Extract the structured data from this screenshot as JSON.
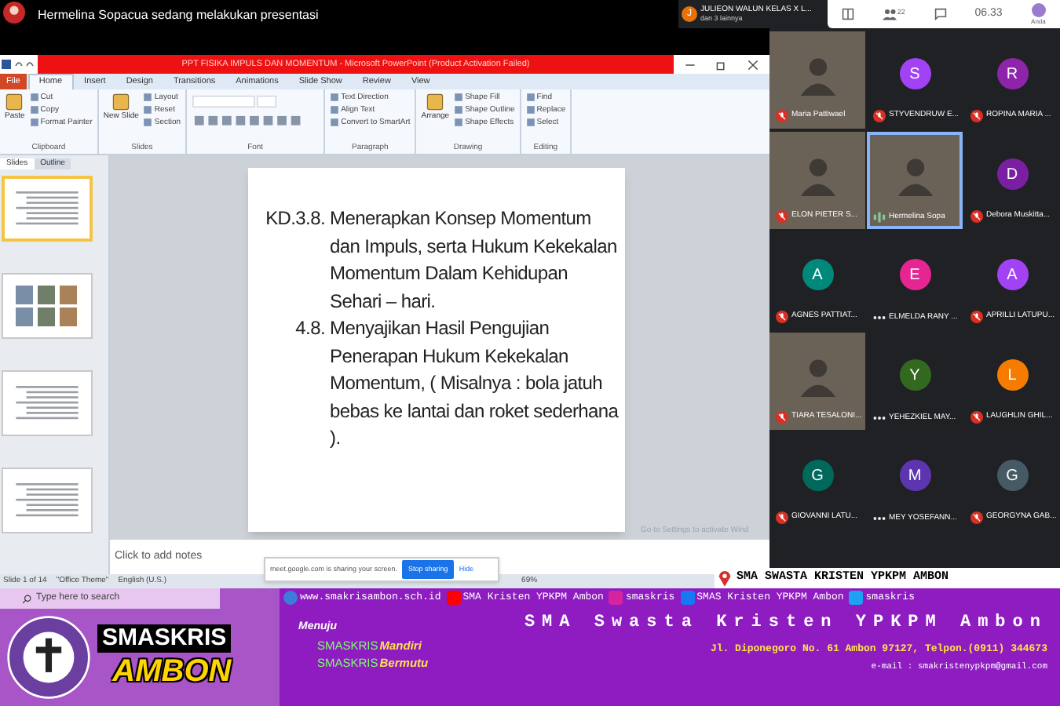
{
  "presenter_bar": {
    "title": "Hermelina Sopacua sedang melakukan presentasi",
    "notice": {
      "initial": "J",
      "name": "JULIEON WALUN KELAS X L...",
      "more": "dan 3 lainnya"
    }
  },
  "meet_toolbar": {
    "participants": "22",
    "time": "06.33",
    "user_label": "Anda"
  },
  "powerpoint": {
    "title": "PPT FISIKA IMPULS DAN MOMENTUM - Microsoft PowerPoint (Product Activation Failed)",
    "tabs": [
      {
        "label": "File",
        "kind": "file",
        "selected": false
      },
      {
        "label": "Home",
        "kind": "tab",
        "selected": true
      },
      {
        "label": "Insert",
        "kind": "tab",
        "selected": false
      },
      {
        "label": "Design",
        "kind": "tab",
        "selected": false
      },
      {
        "label": "Transitions",
        "kind": "tab",
        "selected": false
      },
      {
        "label": "Animations",
        "kind": "tab",
        "selected": false
      },
      {
        "label": "Slide Show",
        "kind": "tab",
        "selected": false
      },
      {
        "label": "Review",
        "kind": "tab",
        "selected": false
      },
      {
        "label": "View",
        "kind": "tab",
        "selected": false
      }
    ],
    "ribbon_groups": [
      {
        "label": "Clipboard",
        "big": "Paste",
        "commands": [
          "Cut",
          "Copy",
          "Format Painter"
        ]
      },
      {
        "label": "Slides",
        "big": "New Slide",
        "commands": [
          "Layout",
          "Reset",
          "Section"
        ]
      },
      {
        "label": "Font",
        "kind": "font"
      },
      {
        "label": "Paragraph",
        "commands": [
          "Text Direction",
          "Align Text",
          "Convert to SmartArt"
        ]
      },
      {
        "label": "Drawing",
        "big": "Arrange",
        "commands": [
          "Shape Fill",
          "Shape Outline",
          "Shape Effects"
        ]
      },
      {
        "label": "Editing",
        "commands": [
          "Find",
          "Replace",
          "Select"
        ]
      }
    ],
    "pane_tabs": [
      {
        "label": "Slides",
        "selected": true
      },
      {
        "label": "Outline",
        "selected": false
      }
    ],
    "thumbnails": [
      {
        "kind": "text",
        "selected": true
      },
      {
        "kind": "images",
        "selected": false
      },
      {
        "kind": "text",
        "selected": false
      },
      {
        "kind": "text",
        "selected": false
      }
    ],
    "slide": {
      "items": [
        {
          "number": "KD.3.8.",
          "text": "Menerapkan Konsep Momentum dan Impuls, serta Hukum Kekekalan Momentum Dalam Kehidupan Sehari – hari."
        },
        {
          "number": "4.8.",
          "text": "Menyajikan Hasil Pengujian Penerapan Hukum Kekekalan Momentum, ( Misalnya : bola jatuh bebas ke lantai dan roket sederhana )."
        }
      ]
    },
    "notes_placeholder": "Click to add notes",
    "status_bar": [
      "Slide 1 of 14",
      "\"Office Theme\"",
      "English (U.S.)"
    ],
    "zoom": "69%",
    "activation_notice": "Go to Settings to activate Wind"
  },
  "share_bar": {
    "message": "meet.google.com is sharing your screen.",
    "stop": "Stop sharing",
    "hide": "Hide"
  },
  "taskbar": {
    "search_placeholder": "Type here to search"
  },
  "gallery": [
    {
      "name": "Maria Pattiwael",
      "kind": "video",
      "muted": true,
      "speaking": false
    },
    {
      "name": "STYVENDRUW E...",
      "kind": "avatar",
      "initial": "S",
      "color": "#a142f4",
      "muted": true,
      "speaking": false
    },
    {
      "name": "ROPINA MARIA ...",
      "kind": "avatar",
      "initial": "R",
      "color": "#8e24aa",
      "muted": true,
      "speaking": false
    },
    {
      "name": "ELON PIETER S...",
      "kind": "video",
      "muted": true,
      "speaking": false
    },
    {
      "name": "Hermelina Sopa",
      "kind": "video",
      "muted": false,
      "speaking": true
    },
    {
      "name": "Debora Muskitta...",
      "kind": "avatar",
      "initial": "D",
      "color": "#7b1fa2",
      "muted": true,
      "speaking": false
    },
    {
      "name": "AGNES PATTIAT...",
      "kind": "avatar",
      "initial": "A",
      "color": "#00897b",
      "muted": true,
      "speaking": false
    },
    {
      "name": "ELMELDA RANY ...",
      "kind": "avatar",
      "initial": "E",
      "color": "#e52592",
      "muted": false,
      "speaking": false
    },
    {
      "name": "APRILLI LATUPU...",
      "kind": "avatar",
      "initial": "A",
      "color": "#a142f4",
      "muted": true,
      "speaking": false
    },
    {
      "name": "TIARA TESALONI...",
      "kind": "video",
      "muted": true,
      "speaking": false
    },
    {
      "name": "YEHEZKIEL MAY...",
      "kind": "avatar",
      "initial": "Y",
      "color": "#33691e",
      "muted": false,
      "speaking": false
    },
    {
      "name": "LAUGHLIN GHIL...",
      "kind": "avatar",
      "initial": "L",
      "color": "#f57c00",
      "muted": true,
      "speaking": false
    },
    {
      "name": "GIOVANNI LATU...",
      "kind": "avatar",
      "initial": "G",
      "color": "#00695c",
      "muted": true,
      "speaking": false
    },
    {
      "name": "MEY YOSEFANN...",
      "kind": "avatar",
      "initial": "M",
      "color": "#5e35b1",
      "muted": false,
      "speaking": false
    },
    {
      "name": "GEORGYNA GAB...",
      "kind": "avatar",
      "initial": "G",
      "color": "#455a64",
      "muted": true,
      "speaking": false
    }
  ],
  "school_strip": "SMA SWASTA KRISTEN YPKPM AMBON",
  "banner": {
    "logo_top": "SMASKRIS",
    "logo_bottom": "AMBON",
    "links": [
      {
        "kind": "web",
        "label": "www.smakrisambon.sch.id"
      },
      {
        "kind": "youtube",
        "label": "SMA Kristen YPKPM Ambon"
      },
      {
        "kind": "instagram",
        "label": "smaskris"
      },
      {
        "kind": "facebook",
        "label": "SMAS Kristen YPKPM Ambon"
      },
      {
        "kind": "twitter",
        "label": "smaskris"
      }
    ],
    "name": "SMA Swasta Kristen YPKPM Ambon",
    "motto_intro": "Menuju",
    "mottos": [
      {
        "prefix": "SMASKRIS",
        "word": "Mandiri"
      },
      {
        "prefix": "SMASKRIS",
        "word": "Bermutu"
      }
    ],
    "address": "Jl. Diponegoro No. 61 Ambon 97127, Telpon.(0911) 344673",
    "email": "e-mail : smakristenypkpm@gmail.com"
  }
}
